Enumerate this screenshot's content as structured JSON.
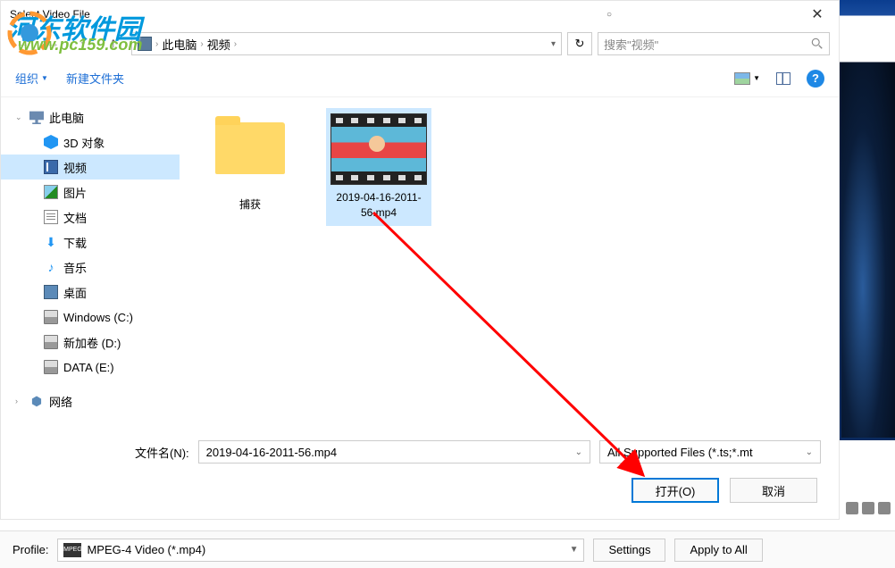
{
  "watermark": {
    "text": "河东软件园",
    "url": "www.pc159.com"
  },
  "titlebar": {
    "title": "Select Video File"
  },
  "nav": {
    "drop_icon": "▾",
    "refresh": "↻"
  },
  "breadcrumb": {
    "root": "此电脑",
    "folder": "视频"
  },
  "search": {
    "placeholder": "搜索\"视频\""
  },
  "toolbar": {
    "organize": "组织",
    "new_folder": "新建文件夹",
    "help": "?"
  },
  "sidebar": {
    "items": [
      {
        "label": "此电脑"
      },
      {
        "label": "3D 对象"
      },
      {
        "label": "视频"
      },
      {
        "label": "图片"
      },
      {
        "label": "文档"
      },
      {
        "label": "下载"
      },
      {
        "label": "音乐"
      },
      {
        "label": "桌面"
      },
      {
        "label": "Windows (C:)"
      },
      {
        "label": "新加卷 (D:)"
      },
      {
        "label": "DATA (E:)"
      },
      {
        "label": "网络"
      }
    ]
  },
  "files": {
    "folder": "捕获",
    "video": "2019-04-16-2011-56.mp4"
  },
  "bottom": {
    "filename_label": "文件名(N):",
    "filename": "2019-04-16-2011-56.mp4",
    "filter": "All Supported Files (*.ts;*.mt",
    "open": "打开(O)",
    "cancel": "取消"
  },
  "profile": {
    "label": "Profile:",
    "value": "MPEG-4 Video (*.mp4)",
    "settings": "Settings",
    "apply": "Apply to All"
  }
}
